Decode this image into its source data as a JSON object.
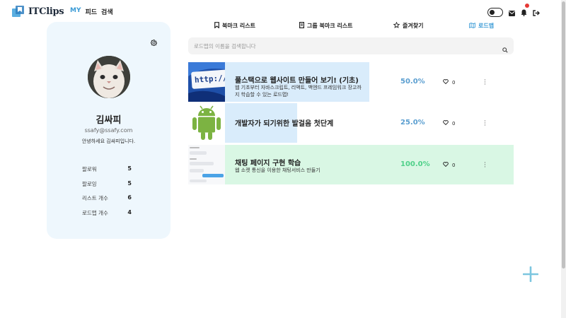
{
  "header": {
    "brand": "ITClips",
    "nav": [
      "MY",
      "피드",
      "검색"
    ]
  },
  "profile": {
    "name": "김싸피",
    "email": "ssafy@ssafy.com",
    "bio": "안녕하세요 김싸피입니다.",
    "stats": [
      {
        "label": "팔로워",
        "value": "5"
      },
      {
        "label": "팔로잉",
        "value": "5"
      },
      {
        "label": "리스트 개수",
        "value": "6"
      },
      {
        "label": "로드맵 개수",
        "value": "4"
      }
    ]
  },
  "tabs": [
    "북마크 리스트",
    "그룹 북마크 리스트",
    "즐겨찾기",
    "로드맵"
  ],
  "search": {
    "placeholder": "로드맵의 이름을 검색합니다"
  },
  "roadmaps": [
    {
      "title": "풀스택으로 웹사이트 만들어 보기! (기초)",
      "desc": "웹 기초부터 자바스크립트, 리액트, 백엔드 프레임워크 장고까지 학습할 수 있는 로드맵!",
      "progress": "50.0%",
      "likes": "0",
      "fill": 0.5
    },
    {
      "title": "개발자가 되기위한 발걸음 첫단계",
      "desc": "",
      "progress": "25.0%",
      "likes": "0",
      "fill": 0.25
    },
    {
      "title": "채팅 페이지 구현 학습",
      "desc": "웹 소켓 통신을 이용한 채팅서비스 만들기",
      "progress": "100.0%",
      "likes": "0",
      "fill": 1.0
    }
  ],
  "thumb_text": {
    "web": "http://w"
  },
  "colors": {
    "accent": "#3b9bd6",
    "progress_blue": "#5a9ed0",
    "progress_green": "#4fd089",
    "panel_blue": "#d9ecfb",
    "panel_green": "#d9f7e4",
    "profile_bg": "#eef7fd"
  }
}
